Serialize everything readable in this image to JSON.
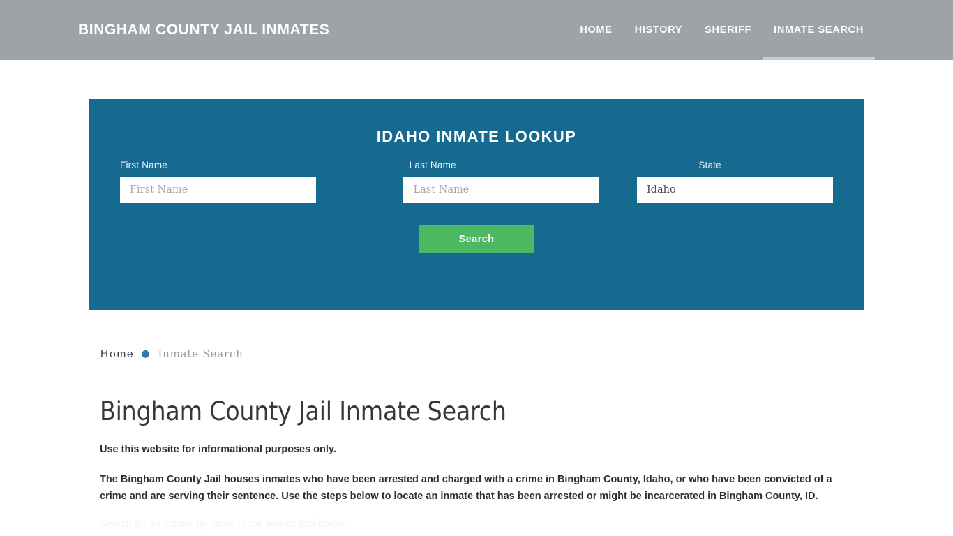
{
  "header": {
    "brand": "Bingham County Jail Inmates",
    "nav": [
      {
        "label": "Home",
        "active": false
      },
      {
        "label": "History",
        "active": false
      },
      {
        "label": "Sheriff",
        "active": false
      },
      {
        "label": "Inmate Search",
        "active": true
      }
    ]
  },
  "lookup": {
    "title": "Idaho Inmate Lookup",
    "fields": [
      {
        "label": "First Name",
        "placeholder": "First Name",
        "value": ""
      },
      {
        "label": "Last Name",
        "placeholder": "Last Name",
        "value": ""
      },
      {
        "label": "State",
        "placeholder": "State",
        "value": "Idaho"
      }
    ],
    "submit_label": "Search"
  },
  "breadcrumb": {
    "home": "Home",
    "separator": "●",
    "current": "Inmate Search"
  },
  "main": {
    "title": "Bingham County Jail Inmate Search",
    "paragraph_1": "Use this website for informational purposes only.",
    "paragraph_2": "The Bingham County Jail houses inmates who have been arrested and charged with a crime in Bingham County, Idaho, or who have been convicted of a crime and are serving their sentence. Use the steps below to locate an inmate that has been arrested or might be incarcerated in Bingham County, ID.",
    "paragraph_3_cut": "Search for an inmate by name in the search tool above"
  },
  "colors": {
    "header_bg": "#9ea3a6",
    "panel_bg": "#166a8f",
    "button_green": "#4cb862",
    "breadcrumb_accent": "#2b7ea1",
    "title_text": "#33393d"
  }
}
